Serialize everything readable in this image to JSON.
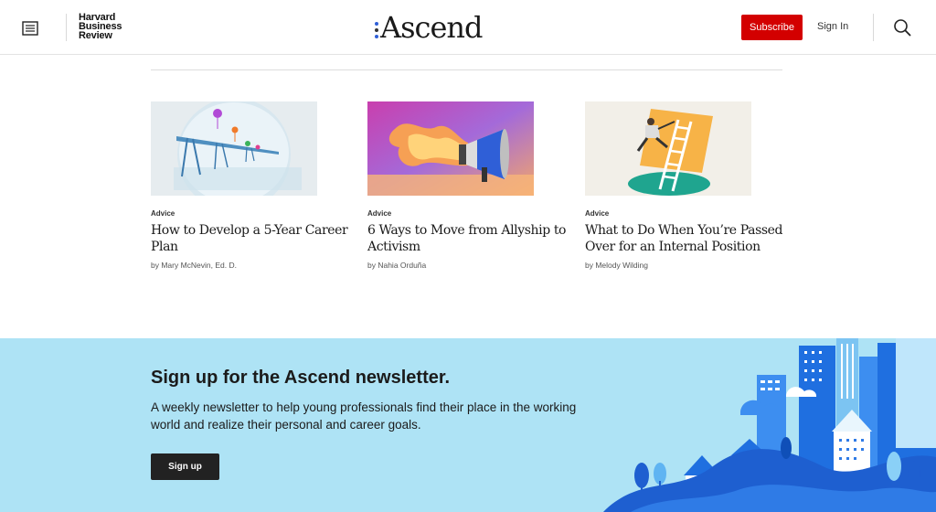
{
  "header": {
    "hbr_logo_lines": [
      "Harvard",
      "Business",
      "Review"
    ],
    "ascend_logo": "Ascend",
    "subscribe_label": "Subscribe",
    "signin_label": "Sign In"
  },
  "articles": [
    {
      "tag": "Advice",
      "title": "How to Develop a 5-Year Career Plan",
      "byline": "by Mary McNevin, Ed. D."
    },
    {
      "tag": "Advice",
      "title": "6 Ways to Move from Allyship to Activism",
      "byline": "by Nahia Orduña"
    },
    {
      "tag": "Advice",
      "title": "What to Do When You’re Passed Over for an Internal Position",
      "byline": "by Melody Wilding"
    }
  ],
  "newsletter": {
    "title": "Sign up for the Ascend newsletter.",
    "description": "A weekly newsletter to help young professionals find their place in the working world and realize their personal and career goals.",
    "signup_label": "Sign up"
  },
  "colors": {
    "accent_red": "#d30000",
    "newsletter_bg": "#aee3f5",
    "brand_blue": "#2f5fd7"
  }
}
